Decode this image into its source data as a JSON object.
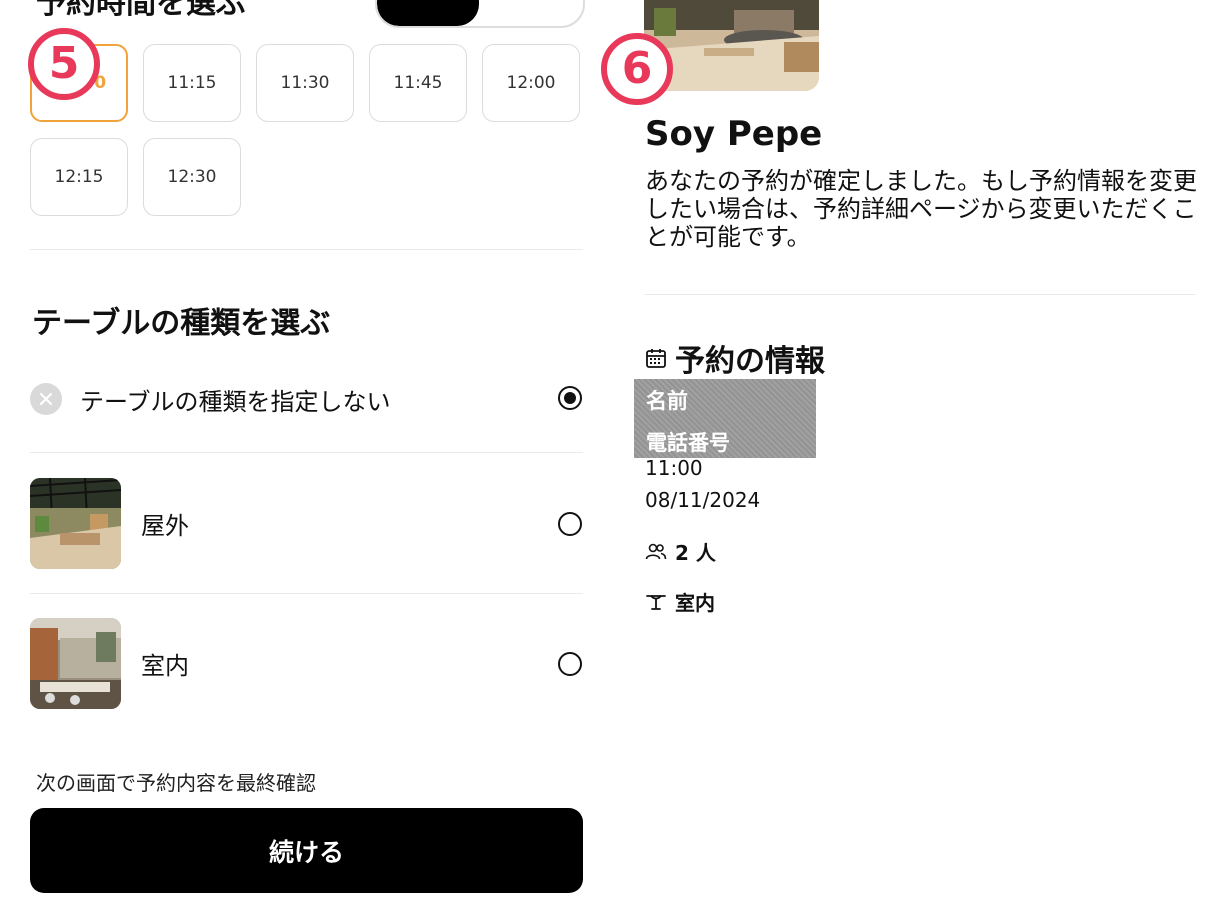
{
  "time_section": {
    "title": "予約時間を選ぶ",
    "slots": [
      {
        "label": "11:00",
        "selected": true
      },
      {
        "label": "11:15",
        "selected": false
      },
      {
        "label": "11:30",
        "selected": false
      },
      {
        "label": "11:45",
        "selected": false
      },
      {
        "label": "12:00",
        "selected": false
      },
      {
        "label": "12:15",
        "selected": false
      },
      {
        "label": "12:30",
        "selected": false
      }
    ]
  },
  "step_badges": {
    "left": "5",
    "right": "6"
  },
  "table_section": {
    "title": "テーブルの種類を選ぶ",
    "options": [
      {
        "label": "テーブルの種類を指定しない",
        "checked": true,
        "icon": "close-icon"
      },
      {
        "label": "屋外",
        "checked": false,
        "icon": "outdoor-photo"
      },
      {
        "label": "室内",
        "checked": false,
        "icon": "indoor-photo"
      }
    ]
  },
  "footer": {
    "note": "次の画面で予約内容を最終確認",
    "continue_label": "続ける"
  },
  "confirmation": {
    "restaurant_name": "Soy Pepe",
    "message": "あなたの予約が確定しました。もし予約情報を変更したい場合は、予約詳細ページから変更いただくことが可能です。",
    "info_title": "予約の情報",
    "name_label": "名前",
    "phone_label": "電話番号",
    "time": "11:00",
    "date": "08/11/2024",
    "party_size": "2 人",
    "table_type": "室内"
  },
  "colors": {
    "accent_selected": "#f0a33a",
    "badge": "#e9395a",
    "button": "#000000"
  }
}
